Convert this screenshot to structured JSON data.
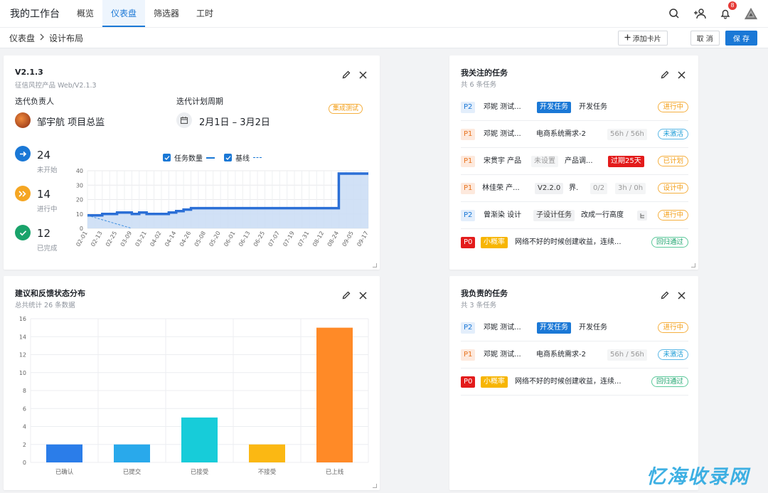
{
  "topbar": {
    "brand": "我的工作台",
    "tabs": [
      "概览",
      "仪表盘",
      "筛选器",
      "工时"
    ],
    "active_tab": 1,
    "notif_count": "8"
  },
  "breadcrumb": {
    "parent": "仪表盘",
    "current": "设计布局"
  },
  "actions": {
    "add_card": "添加卡片",
    "cancel": "取 消",
    "save": "保 存"
  },
  "version_card": {
    "title": "V2.1.3",
    "subtitle": "征信风控产品 Web/V2.1.3",
    "owner_label": "迭代负责人",
    "owner_name": "邹宇航 项目总监",
    "period_label": "迭代计划周期",
    "period": "2月1日 – 3月2日",
    "phase_tag": "集成测试",
    "stats": [
      {
        "num": "24",
        "label": "未开始"
      },
      {
        "num": "14",
        "label": "进行中"
      },
      {
        "num": "12",
        "label": "已完成"
      }
    ],
    "legend_tasks": "任务数量",
    "legend_baseline": "基线"
  },
  "chart_data": [
    {
      "type": "area",
      "title": "",
      "series": [
        {
          "name": "任务数量",
          "x": [
            "02-01",
            "02-07",
            "02-13",
            "02-19",
            "02-25",
            "03-03",
            "03-09",
            "03-15",
            "03-21",
            "03-27",
            "04-02",
            "04-08",
            "04-14",
            "04-20",
            "04-26",
            "05-02",
            "05-08",
            "05-14",
            "05-20",
            "05-26",
            "06-01",
            "06-07",
            "06-13",
            "06-19",
            "06-25",
            "07-01",
            "07-07",
            "07-13",
            "07-19",
            "07-25",
            "07-31",
            "08-06",
            "08-12",
            "08-18",
            "08-24",
            "08-30",
            "09-05",
            "09-11",
            "09-17"
          ],
          "values": [
            9,
            9,
            10,
            10,
            11,
            11,
            10,
            11,
            10,
            10,
            10,
            11,
            12,
            13,
            14,
            14,
            14,
            14,
            14,
            14,
            14,
            14,
            14,
            14,
            14,
            14,
            14,
            14,
            14,
            14,
            14,
            14,
            14,
            14,
            38,
            38,
            38,
            38,
            38
          ]
        },
        {
          "name": "基线",
          "x": [
            "02-01",
            "03-09"
          ],
          "values": [
            9,
            0
          ]
        }
      ],
      "ylim": [
        0,
        40
      ],
      "yticks": [
        0,
        10,
        20,
        30,
        40
      ],
      "xticks": [
        "02-01",
        "02-13",
        "02-25",
        "03-09",
        "03-21",
        "04-02",
        "04-14",
        "04-26",
        "05-08",
        "05-20",
        "06-01",
        "06-13",
        "06-25",
        "07-07",
        "07-19",
        "07-31",
        "08-12",
        "08-24",
        "09-05",
        "09-17"
      ],
      "grid": true,
      "legend": "top"
    },
    {
      "type": "bar",
      "title": "建议和反馈状态分布",
      "subtitle": "总共统计 26 条数据",
      "categories": [
        "已确认",
        "已提交",
        "已接受",
        "不接受",
        "已上线"
      ],
      "values": [
        2,
        2,
        5,
        2,
        15
      ],
      "colors": [
        "#2b7de9",
        "#29a9eb",
        "#17ccd9",
        "#fbb813",
        "#ff8a27"
      ],
      "ylim": [
        0,
        16
      ],
      "yticks": [
        0,
        2,
        4,
        6,
        8,
        10,
        12,
        14,
        16
      ],
      "grid": true
    }
  ],
  "followed_tasks": {
    "title": "我关注的任务",
    "subtitle": "共 6 条任务",
    "rows": [
      {
        "priority": "P2",
        "assignee": "邓妮 测试...",
        "type": "开发任务",
        "name": "开发任务",
        "status": "进行中"
      },
      {
        "priority": "P1",
        "assignee": "邓妮 测试...",
        "name": "电商系统需求-2",
        "hours": "56h / 56h",
        "status": "未激活"
      },
      {
        "priority": "P1",
        "assignee": "宋贯宇 产品",
        "unset": "未设置",
        "name": "产品调...",
        "overdue": "过期25天",
        "status": "已计划"
      },
      {
        "priority": "P1",
        "assignee": "林佳荣 产...",
        "version": "V2.2.0",
        "name": "界.",
        "progress": "0/2",
        "hours": "3h / 0h",
        "status": "设计中"
      },
      {
        "priority": "P2",
        "assignee": "曾渐染 设计",
        "type": "子设计任务",
        "name": "改成一行高度",
        "status": "进行中"
      },
      {
        "priority": "P0",
        "prob": "小概率",
        "name": "网络不好的时候创建收益，连续...",
        "status": "回归通过"
      }
    ]
  },
  "my_tasks": {
    "title": "我负责的任务",
    "subtitle": "共 3 条任务",
    "rows": [
      {
        "priority": "P2",
        "assignee": "邓妮 测试...",
        "type": "开发任务",
        "name": "开发任务",
        "status": "进行中"
      },
      {
        "priority": "P1",
        "assignee": "邓妮 测试...",
        "name": "电商系统需求-2",
        "hours": "56h / 56h",
        "status": "未激活"
      },
      {
        "priority": "P0",
        "prob": "小概率",
        "name": "网络不好的时候创建收益，连续...",
        "status": "回归通过"
      }
    ]
  },
  "watermark": "忆海收录网"
}
